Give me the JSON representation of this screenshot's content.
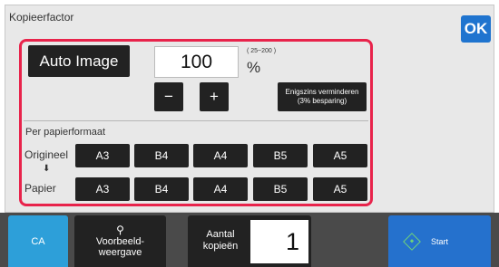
{
  "panel": {
    "title": "Kopieerfactor",
    "ok_label": "OK"
  },
  "zoom": {
    "auto_image_label": "Auto Image",
    "value": "100",
    "range": "( 25~200 )",
    "unit": "%",
    "decrease_label": "−",
    "increase_label": "+",
    "slight_reduce_line1": "Enigszins verminderen",
    "slight_reduce_line2": "(3% besparing)"
  },
  "paper_size": {
    "section_label": "Per papierformaat",
    "original_label": "Origineel",
    "paper_label": "Papier",
    "arrow": "⬇",
    "original_sizes": [
      "A3",
      "B4",
      "A4",
      "B5",
      "A5"
    ],
    "paper_sizes": [
      "A3",
      "B4",
      "A4",
      "B5",
      "A5"
    ]
  },
  "bottom": {
    "ca_label": "CA",
    "preview_line1": "Voorbeeld-",
    "preview_line2": "weergave",
    "copies_line1": "Aantal",
    "copies_line2": "kopieën",
    "copies_value": "1",
    "start_label": "Start"
  },
  "colors": {
    "highlight": "#e8234b",
    "ok_button": "#1f74cf",
    "ca_button": "#2d9fd9",
    "start_button": "#2571cd"
  }
}
